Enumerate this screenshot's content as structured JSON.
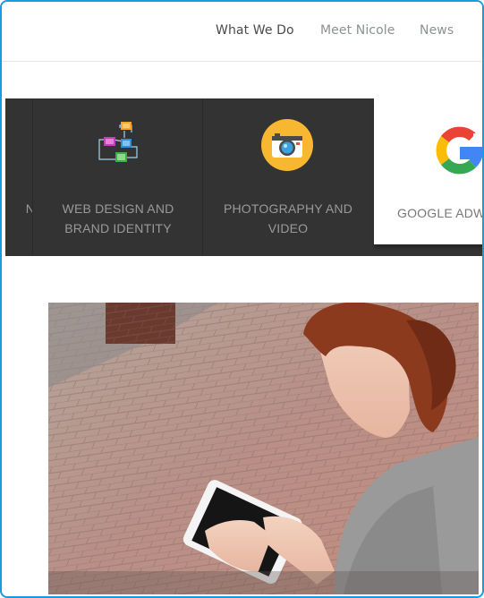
{
  "nav": {
    "items": [
      {
        "label": "What We Do"
      },
      {
        "label": "Meet Nicole"
      },
      {
        "label": "News"
      }
    ]
  },
  "services": [
    {
      "label": "N",
      "icon": "unknown-icon"
    },
    {
      "label": "WEB DESIGN AND\nBRAND IDENTITY",
      "icon": "website-network-icon"
    },
    {
      "label": "PHOTOGRAPHY AND\nVIDEO",
      "icon": "camera-icon"
    },
    {
      "label": "GOOGLE ADW",
      "icon": "google-icon"
    }
  ],
  "hero_image": {
    "icon": "woman-with-tablet-photo"
  },
  "colors": {
    "frame_border": "#1a9be0",
    "services_bg": "#333333",
    "camera_circle": "#f7b731"
  }
}
